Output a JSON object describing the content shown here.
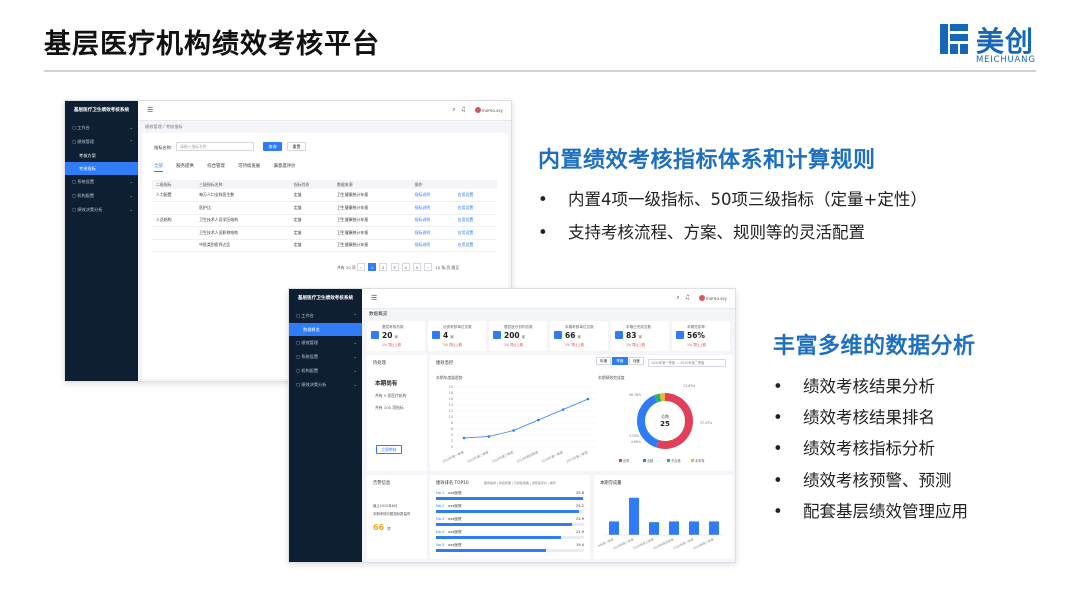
{
  "page": {
    "title": "基层医疗机构绩效考核平台"
  },
  "logo": {
    "name_cn": "美创",
    "name_en": "MEICHUANG"
  },
  "colors": {
    "accent": "#1e6fc2",
    "sidebar_bg": "#0f1f33",
    "primary_button": "#2f7cf6"
  },
  "sections": [
    {
      "heading": "内置绩效考核指标体系和计算规则",
      "bullets": [
        "内置4项一级指标、50项三级指标（定量+定性）",
        "支持考核流程、方案、规则等的灵活配置"
      ]
    },
    {
      "heading": "丰富多维的数据分析",
      "bullets": [
        "绩效考核结果分析",
        "绩效考核结果排名",
        "绩效考核指标分析",
        "绩效考核预警、预测",
        "配套基层绩效管理应用"
      ]
    }
  ],
  "screenshot1": {
    "sidebar": {
      "title": "基层医疗卫生绩效考核系统",
      "items": [
        "工作台",
        "绩效管理",
        "系统设置",
        "机构配置",
        "绩效决策分析"
      ],
      "subitems": [
        "考核方案",
        "考核指标"
      ]
    },
    "topbar": {
      "user": "momo.ssy"
    },
    "breadcrumb": "绩效管理 / 考核指标",
    "search": {
      "label": "指标名称:",
      "placeholder": "请输入指标名称",
      "query_label": "查询",
      "reset_label": "重置"
    },
    "tabs": [
      "全部",
      "服务提供",
      "综合管理",
      "可持续发展",
      "满意度评价"
    ],
    "table": {
      "headers": [
        "二级指标",
        "三级指标名称",
        "指标性质",
        "数据来源",
        "操作"
      ],
      "rows": [
        [
          "人力配置",
          "每万人口全科医生数",
          "定量",
          "卫生健康统计年报",
          "指标说明",
          "应用设置"
        ],
        [
          "",
          "医护比",
          "定量",
          "卫生健康统计年报",
          "指标说明",
          "应用设置"
        ],
        [
          "人员结构",
          "卫生技术人员学历结构",
          "定量",
          "卫生健康统计年报",
          "指标说明",
          "应用设置"
        ],
        [
          "",
          "卫生技术人员职称结构",
          "定量",
          "卫生健康统计年报",
          "指标说明",
          "应用设置"
        ],
        [
          "",
          "中医类别医师占比",
          "定量",
          "卫生健康统计年报",
          "指标说明",
          "应用设置"
        ]
      ]
    },
    "pager": {
      "total": "共有 20 项",
      "pages": [
        "1",
        "2",
        "3",
        "4",
        "5"
      ],
      "per_page": "10 条/页",
      "jump": "跳至"
    }
  },
  "screenshot2": {
    "sidebar": {
      "title": "基层医疗卫生绩效考核系统",
      "items": [
        "工作台",
        "绩效管理",
        "系统设置",
        "机构配置",
        "绩效决策分析"
      ],
      "subitems": [
        "数据概览"
      ]
    },
    "topbar": {
      "user": "momo.ssy"
    },
    "page_title": "数据概览",
    "stats": [
      {
        "label": "基层考核总数",
        "value": "20",
        "unit": "家",
        "change": "1%  同比上期"
      },
      {
        "label": "优秀考核单位总数",
        "value": "4",
        "unit": "家",
        "change": "1%  同比上期"
      },
      {
        "label": "基层医疗机构总数",
        "value": "200",
        "unit": "家",
        "change": "1%  同比上期"
      },
      {
        "label": "本期考核单位总数",
        "value": "66",
        "unit": "家",
        "change": "1%  同比上期"
      },
      {
        "label": "本期已完成总数",
        "value": "83",
        "unit": "家",
        "change": "1%  同比上期"
      },
      {
        "label": "本期完成率",
        "value": "56%",
        "unit": "",
        "change": "1%  同比上期"
      }
    ],
    "todo": {
      "title": "待处理",
      "heading": "本期尚有",
      "line1": "共有 5 家医疗机构",
      "line2": "共有 100 项指标",
      "button": "立即审核"
    },
    "monitor": {
      "title": "绩效监控",
      "toggles": [
        "年度",
        "季度",
        "月度"
      ],
      "range": "2020年第一季度 — 2020年第二季度",
      "trend_title": "本期年度量趋势",
      "ring_title": "本期绩效完成度"
    },
    "warning": {
      "title": "告警信息",
      "line1": "截止2020年8月",
      "line2": "本期考核问题指标数量有",
      "value": "66",
      "unit": "项"
    },
    "ranking": {
      "title": "绩效排名 TOP10",
      "filters": [
        "服务提供",
        "综合管理",
        "可持续发展",
        "满意度评价",
        "排序"
      ],
      "items": [
        {
          "rank": "No.1",
          "name": "xxx医院",
          "score": "25.8"
        },
        {
          "rank": "No.2",
          "name": "xxx医院",
          "score": "25.2"
        },
        {
          "rank": "No.3",
          "name": "xxx医院",
          "score": "23.9"
        },
        {
          "rank": "No.4",
          "name": "xxx医院",
          "score": "21.9"
        },
        {
          "rank": "No.5",
          "name": "xxx医院",
          "score": "19.4"
        }
      ]
    },
    "bars_title": "本期完成量"
  },
  "chart_data": [
    {
      "type": "line",
      "x": [
        "2019年第一季度",
        "2019年第二季度",
        "2019年第三季度",
        "2019年第四季度",
        "2020年第一季度",
        "2020年第二季度"
      ],
      "values": [
        3,
        3.5,
        5.5,
        9,
        12.5,
        16
      ],
      "ylim": [
        0,
        20
      ]
    },
    {
      "type": "pie",
      "labels": [
        "优秀",
        "合格",
        "不合格",
        "未考核"
      ],
      "values": [
        54.9,
        38.8,
        3.3,
        3.0
      ],
      "center_label": "总数",
      "center_value": "25",
      "colors": [
        "#e0405a",
        "#2f7cf6",
        "#29b36a",
        "#f5b335"
      ],
      "outer_labels": [
        "56.76%",
        "37.03%",
        "3.33%",
        "4.66%",
        "13.63%"
      ]
    },
    {
      "type": "bar",
      "categories": [
        "2019年第一季度",
        "2019年第二季度",
        "2019年第三季度",
        "2019年第四季度",
        "2020年第一季度",
        "2020年第二季度"
      ],
      "values": [
        4,
        11,
        3.8,
        4,
        4,
        4
      ],
      "ylim": [
        0,
        13
      ]
    }
  ]
}
